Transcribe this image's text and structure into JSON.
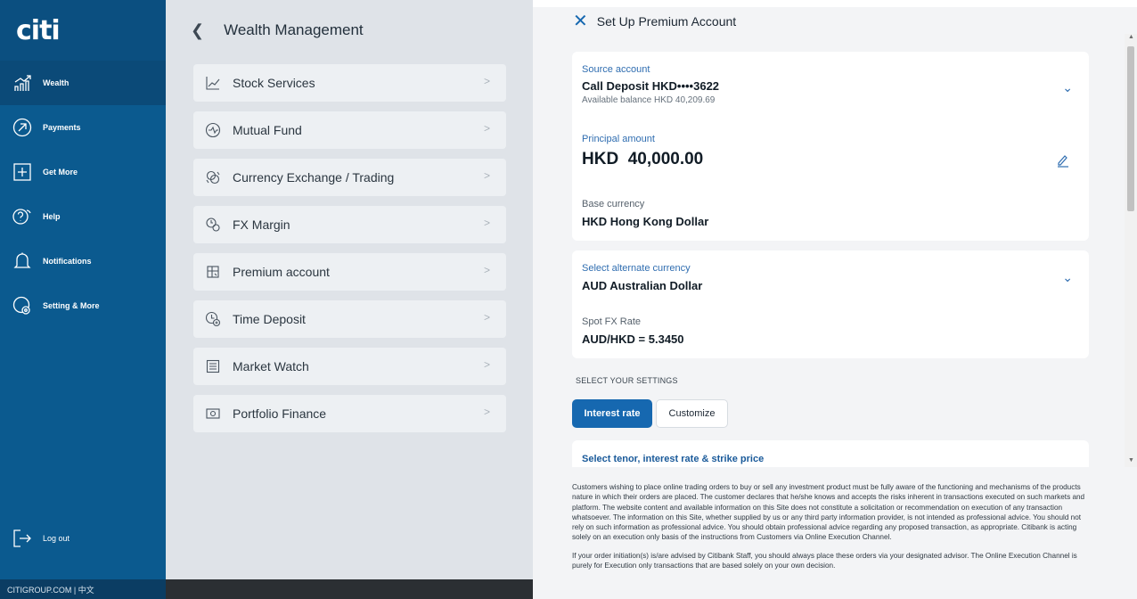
{
  "nav": {
    "logo": "citi",
    "items": [
      {
        "label": "Wealth",
        "icon": "chart-up-icon"
      },
      {
        "label": "Payments",
        "icon": "payment-arrow-icon"
      },
      {
        "label": "Get More",
        "icon": "plus-box-icon"
      },
      {
        "label": "Help",
        "icon": "help-bubble-icon"
      },
      {
        "label": "Notifications",
        "icon": "bell-icon"
      },
      {
        "label": "Setting & More",
        "icon": "settings-gear-icon"
      }
    ],
    "logout": "Log out",
    "footer": "CITIGROUP.COM  |  中文"
  },
  "menu": {
    "title": "Wealth Management",
    "items": [
      {
        "label": "Stock Services",
        "icon": "stock-chart-icon"
      },
      {
        "label": "Mutual Fund",
        "icon": "fund-icon"
      },
      {
        "label": "Currency Exchange / Trading",
        "icon": "currency-exchange-icon"
      },
      {
        "label": "FX Margin",
        "icon": "fx-margin-icon"
      },
      {
        "label": "Premium account",
        "icon": "premium-account-icon"
      },
      {
        "label": "Time Deposit",
        "icon": "time-deposit-icon"
      },
      {
        "label": "Market Watch",
        "icon": "market-watch-icon"
      },
      {
        "label": "Portfolio Finance",
        "icon": "portfolio-finance-icon"
      }
    ]
  },
  "panel": {
    "title": "Set Up Premium Account",
    "source": {
      "label": "Source account",
      "value": "Call Deposit HKD••••3622",
      "balance": "Available balance HKD 40,209.69"
    },
    "principal": {
      "label": "Principal amount",
      "value": "HKD  40,000.00"
    },
    "base": {
      "label": "Base currency",
      "value": "HKD Hong Kong Dollar"
    },
    "alternate": {
      "label": "Select alternate currency",
      "value": "AUD Australian Dollar"
    },
    "spot": {
      "label": "Spot FX Rate",
      "value": "AUD/HKD = 5.3450"
    },
    "settings_label": "SELECT YOUR SETTINGS",
    "tab_interest": "Interest rate",
    "tab_customize": "Customize",
    "tenor_label": "Select tenor, interest rate & strike price",
    "disclaimer1": "Customers wishing to place online trading orders to buy or sell any investment product must be fully aware of the functioning and mechanisms of the products nature in which their orders are placed. The customer declares that he/she knows and accepts the risks inherent in transactions executed on such markets and platform. The website content and available information on this Site does not constitute a solicitation or recommendation on execution of any transaction whatsoever. The information on this Site, whether supplied by us or any third party information provider, is not intended as professional advice. You should not rely on such information as professional advice. You should obtain professional advice regarding any proposed transaction, as appropriate. Citibank is acting solely on an execution only basis of the instructions from Customers via Online Execution Channel.",
    "disclaimer2": "If your order initiation(s) is/are advised by Citibank Staff, you should always place these orders via your designated advisor. The Online Execution Channel is purely for Execution only transactions that are based solely on your own decision."
  }
}
